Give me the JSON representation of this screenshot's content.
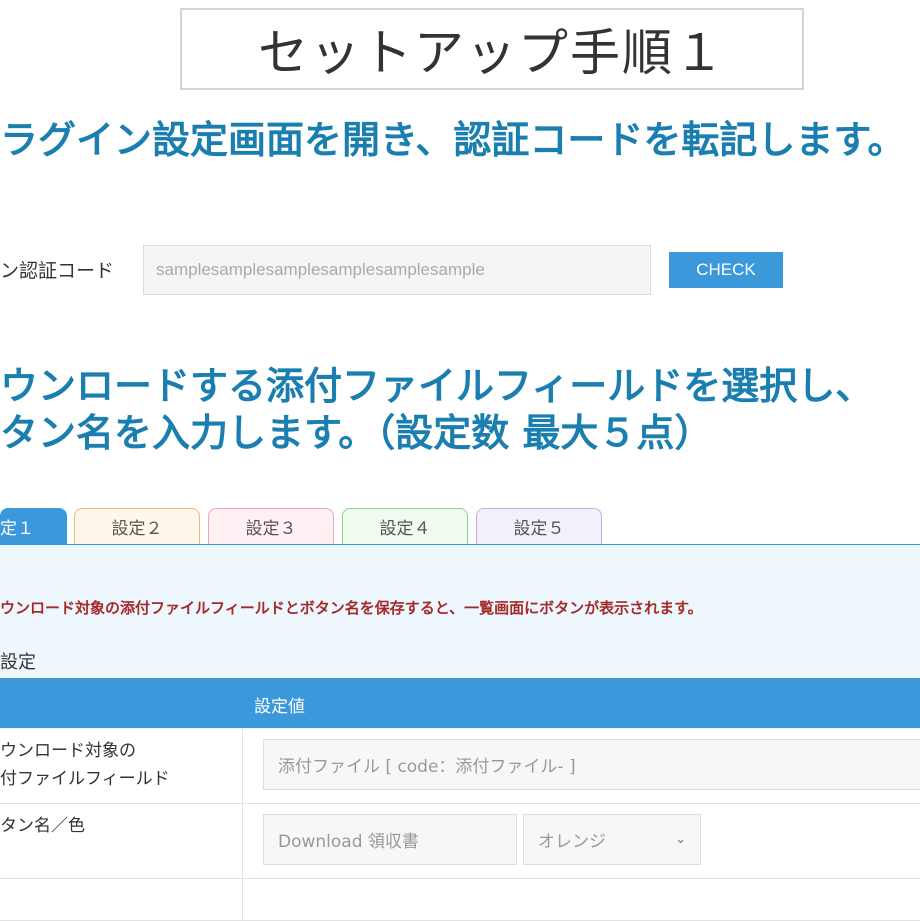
{
  "title": "セットアップ手順１",
  "step1": {
    "heading": "ラグイン設定画面を開き、認証コードを転記します。",
    "auth_label": "ン認証コード",
    "auth_value": "samplesamplesamplesamplesamplesample",
    "check_label": "CHECK"
  },
  "step2": {
    "heading_line1": "ウンロードする添付ファイルフィールドを選択し、",
    "heading_line2": "タン名を入力します。（設定数 最大５点）"
  },
  "tabs": [
    {
      "label": "定１"
    },
    {
      "label": "設定２"
    },
    {
      "label": "設定３"
    },
    {
      "label": "設定４"
    },
    {
      "label": "設定５"
    }
  ],
  "panel": {
    "notice": "ウンロード対象の添付ファイルフィールドとボタン名を保存すると、一覧画面にボタンが表示されます。",
    "section_label": "設定",
    "header_value": "設定値",
    "rows": [
      {
        "label_line1": "ウンロード対象の",
        "label_line2": "付ファイルフィールド",
        "field": "添付ファイル [ code：添付ファイル- ]"
      },
      {
        "label_line1": "タン名／色",
        "button_name": "Download 領収書",
        "color": "オレンジ"
      }
    ]
  },
  "colors": {
    "heading": "#1a7fb0",
    "accent": "#3a98db",
    "notice": "#a52a2a",
    "panel_bg": "#edf7fd"
  }
}
